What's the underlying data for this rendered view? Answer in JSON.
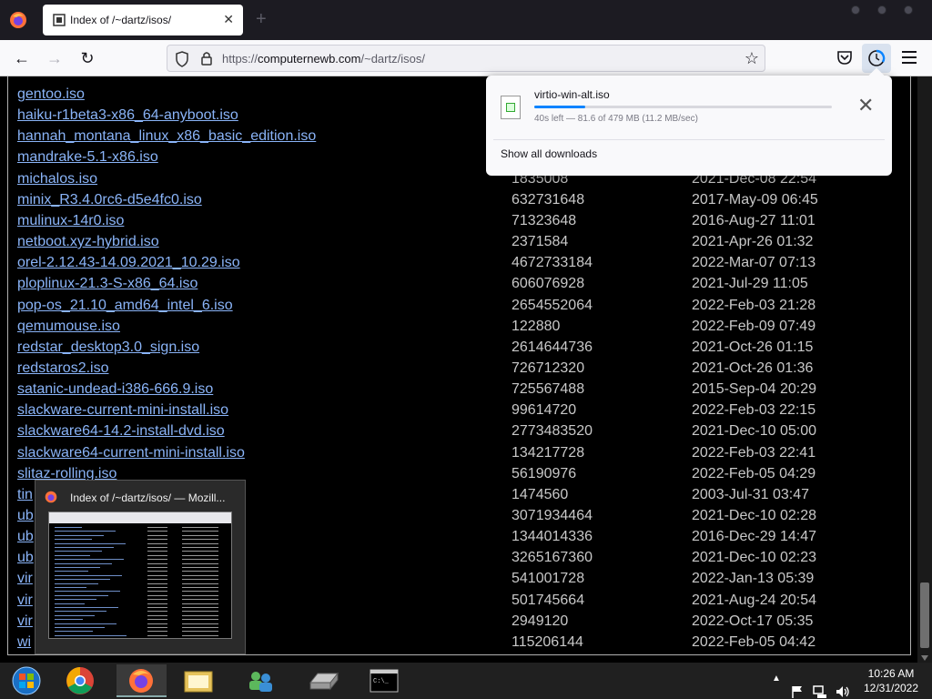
{
  "browser": {
    "tab": {
      "title": "Index of /~dartz/isos/"
    },
    "url": {
      "prefix": "https://",
      "host": "computernewb.com",
      "path": "/~dartz/isos/"
    }
  },
  "listing": {
    "partial_top_name": "gentoo.iso",
    "rows": [
      {
        "name": "gentoo.iso",
        "size": "",
        "date": ""
      },
      {
        "name": "haiku-r1beta3-x86_64-anyboot.iso",
        "size": "",
        "date": ""
      },
      {
        "name": "hannah_montana_linux_x86_basic_edition.iso",
        "size": "",
        "date": ""
      },
      {
        "name": "mandrake-5.1-x86.iso",
        "size": "",
        "date": ""
      },
      {
        "name": "michalos.iso",
        "size": "1835008",
        "date": "2021-Dec-08 22:54"
      },
      {
        "name": "minix_R3.4.0rc6-d5e4fc0.iso",
        "size": "632731648",
        "date": "2017-May-09 06:45"
      },
      {
        "name": "mulinux-14r0.iso",
        "size": "71323648",
        "date": "2016-Aug-27 11:01"
      },
      {
        "name": "netboot.xyz-hybrid.iso",
        "size": "2371584",
        "date": "2021-Apr-26 01:32"
      },
      {
        "name": "orel-2.12.43-14.09.2021_10.29.iso",
        "size": "4672733184",
        "date": "2022-Mar-07 07:13"
      },
      {
        "name": "ploplinux-21.3-S-x86_64.iso",
        "size": "606076928",
        "date": "2021-Jul-29 11:05"
      },
      {
        "name": "pop-os_21.10_amd64_intel_6.iso",
        "size": "2654552064",
        "date": "2022-Feb-03 21:28"
      },
      {
        "name": "qemumouse.iso",
        "size": "122880",
        "date": "2022-Feb-09 07:49"
      },
      {
        "name": "redstar_desktop3.0_sign.iso",
        "size": "2614644736",
        "date": "2021-Oct-26 01:15"
      },
      {
        "name": "redstaros2.iso",
        "size": "726712320",
        "date": "2021-Oct-26 01:36"
      },
      {
        "name": "satanic-undead-i386-666.9.iso",
        "size": "725567488",
        "date": "2015-Sep-04 20:29"
      },
      {
        "name": "slackware-current-mini-install.iso",
        "size": "99614720",
        "date": "2022-Feb-03 22:15"
      },
      {
        "name": "slackware64-14.2-install-dvd.iso",
        "size": "2773483520",
        "date": "2021-Dec-10 05:00"
      },
      {
        "name": "slackware64-current-mini-install.iso",
        "size": "134217728",
        "date": "2022-Feb-03 22:41"
      },
      {
        "name": "slitaz-rolling.iso",
        "size": "56190976",
        "date": "2022-Feb-05 04:29"
      },
      {
        "name": "tin",
        "size": "1474560",
        "date": "2003-Jul-31 03:47"
      },
      {
        "name": "ub",
        "size": "3071934464",
        "date": "2021-Dec-10 02:28"
      },
      {
        "name": "ub",
        "size": "1344014336",
        "date": "2016-Dec-29 14:47"
      },
      {
        "name": "ub",
        "size": "3265167360",
        "date": "2021-Dec-10 02:23"
      },
      {
        "name": "vir",
        "size": "541001728",
        "date": "2022-Jan-13 05:39"
      },
      {
        "name": "vir",
        "size": "501745664",
        "date": "2021-Aug-24 20:54"
      },
      {
        "name": "vir",
        "size": "2949120",
        "date": "2022-Oct-17 05:35"
      },
      {
        "name": "wi",
        "size": "115206144",
        "date": "2022-Feb-05 04:42"
      }
    ]
  },
  "downloads": {
    "filename": "virtio-win-alt.iso",
    "status": "40s left — 81.6 of 479 MB (11.2 MB/sec)",
    "progress": 0.17,
    "show_all": "Show all downloads"
  },
  "taskbar": {
    "preview_title": "Index of /~dartz/isos/ — Mozill...",
    "time": "10:26 AM",
    "date": "12/31/2022"
  },
  "colors": {
    "link": "#8ab4f8",
    "accent": "#0a84ff",
    "taskbar": "#202020"
  }
}
